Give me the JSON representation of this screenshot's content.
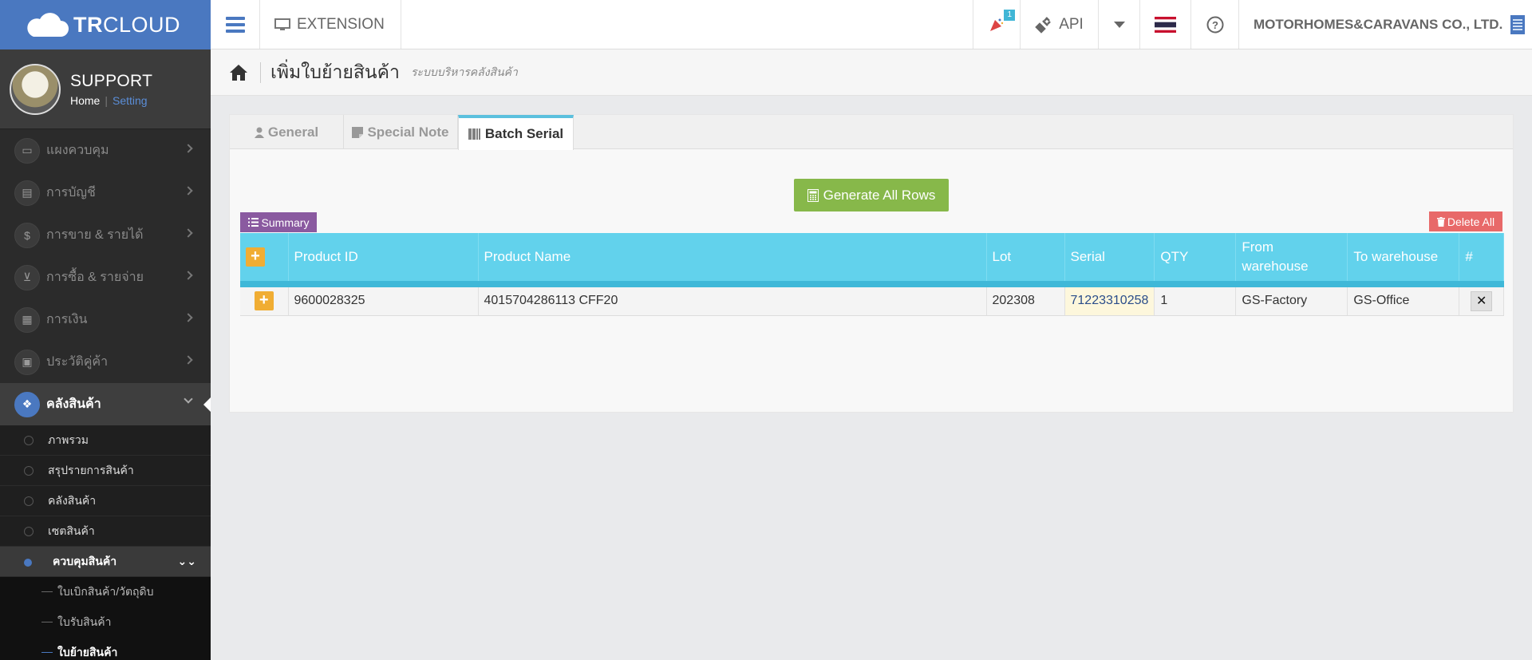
{
  "app": {
    "logo_bold": "TR",
    "logo_light": "CLOUD"
  },
  "topbar": {
    "extension_label": "EXTENSION",
    "notification_count": "1",
    "api_label": "API",
    "company": "MOTORHOMES&CARAVANS CO., LTD."
  },
  "profile": {
    "name": "SUPPORT",
    "home": "Home",
    "separator": "|",
    "setting": "Setting"
  },
  "sidebar": {
    "items": [
      {
        "label": "แผงควบคุม",
        "icon": "monitor-icon"
      },
      {
        "label": "การบัญชี",
        "icon": "book-icon"
      },
      {
        "label": "การขาย & รายได้",
        "icon": "dollar-icon"
      },
      {
        "label": "การซื้อ & รายจ่าย",
        "icon": "cart-icon"
      },
      {
        "label": "การเงิน",
        "icon": "calendar-icon"
      },
      {
        "label": "ประวัติคู่ค้า",
        "icon": "contact-icon"
      },
      {
        "label": "คลังสินค้า",
        "icon": "cubes-icon"
      }
    ],
    "sub_items": [
      "ภาพรวม",
      "สรุปรายการสินค้า",
      "คลังสินค้า",
      "เซตสินค้า"
    ],
    "open_sub": "ควบคุมสินค้า",
    "subsub_items": [
      "ใบเบิกสินค้า/วัตถุดิบ",
      "ใบรับสินค้า",
      "ใบย้ายสินค้า"
    ]
  },
  "breadcrumb": {
    "title": "เพิ่มใบย้ายสินค้า",
    "subtitle": "ระบบบริหารคลังสินค้า"
  },
  "tabs": [
    "General",
    "Special Note",
    "Batch Serial"
  ],
  "actions": {
    "generate": "Generate All Rows",
    "summary": "Summary",
    "delete_all": "Delete All"
  },
  "table": {
    "headers": [
      "Product ID",
      "Product Name",
      "Lot",
      "Serial",
      "QTY",
      "From warehouse",
      "To warehouse",
      "#"
    ],
    "rows": [
      {
        "product_id": "9600028325",
        "product_name": "4015704286113 CFF20",
        "lot": "202308",
        "serial": "71223310258",
        "qty": "1",
        "from": "GS-Factory",
        "to": "GS-Office"
      }
    ]
  },
  "colors": {
    "brand": "#4a78c0",
    "table_header": "#62d2ec",
    "generate": "#87b84a",
    "summary": "#8a5aa0",
    "delete": "#e86969",
    "add": "#f0ad33"
  }
}
